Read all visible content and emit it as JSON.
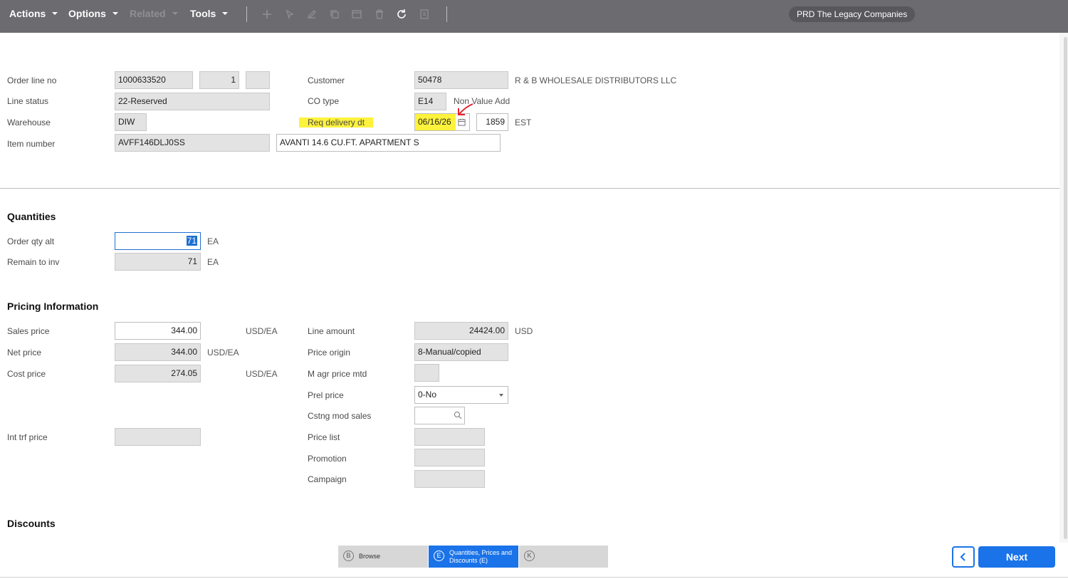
{
  "toolbar": {
    "menus": {
      "actions": "Actions",
      "options": "Options",
      "related": "Related",
      "tools": "Tools"
    },
    "icons": [
      "add-icon",
      "cursor-icon",
      "edit-icon",
      "copy-icon",
      "window-icon",
      "delete-icon",
      "refresh-icon",
      "note-icon"
    ],
    "company": "PRD The Legacy Companies"
  },
  "header": {
    "order_line_no": {
      "label": "Order line no",
      "order": "1000633520",
      "line": "1",
      "suffix": ""
    },
    "line_status": {
      "label": "Line status",
      "value": "22-Reserved"
    },
    "warehouse": {
      "label": "Warehouse",
      "value": "DIW"
    },
    "item_number": {
      "label": "Item number",
      "value": "AVFF146DLJ0SS",
      "description": "AVANTI 14.6 CU.FT. APARTMENT S"
    },
    "customer": {
      "label": "Customer",
      "value": "50478",
      "name": "R & B WHOLESALE DISTRIBUTORS LLC"
    },
    "co_type": {
      "label": "CO type",
      "value": "E14",
      "description": "Non Value Add"
    },
    "req_delivery": {
      "label": "Req delivery dt",
      "date": "06/16/26",
      "time": "1859",
      "timezone": "EST"
    }
  },
  "quantities": {
    "title": "Quantities",
    "order_qty_alt": {
      "label": "Order qty alt",
      "value": "71",
      "unit": "EA"
    },
    "remain_to_inv": {
      "label": "Remain to inv",
      "value": "71",
      "unit": "EA"
    }
  },
  "pricing": {
    "title": "Pricing Information",
    "sales_price": {
      "label": "Sales price",
      "value": "344.00",
      "unit": "USD/EA"
    },
    "net_price": {
      "label": "Net price",
      "value": "344.00",
      "unit": "USD/EA"
    },
    "cost_price": {
      "label": "Cost price",
      "value": "274.05",
      "unit": "USD/EA"
    },
    "int_trf_price": {
      "label": "Int trf price",
      "value": ""
    },
    "line_amount": {
      "label": "Line amount",
      "value": "24424.00",
      "unit": "USD"
    },
    "price_origin": {
      "label": "Price origin",
      "value": "8-Manual/copied"
    },
    "m_agr_price_mtd": {
      "label": "M agr price mtd",
      "value": ""
    },
    "prel_price": {
      "label": "Prel price",
      "value": "0-No"
    },
    "cstng_mod_sales": {
      "label": "Cstng mod sales",
      "value": ""
    },
    "price_list": {
      "label": "Price list",
      "value": ""
    },
    "promotion": {
      "label": "Promotion",
      "value": ""
    },
    "campaign": {
      "label": "Campaign",
      "value": ""
    }
  },
  "discounts": {
    "title": "Discounts"
  },
  "nav": {
    "steps": [
      {
        "key": "B",
        "label": "Browse"
      },
      {
        "key": "E",
        "label_line1": "Quantities, Prices and",
        "label_line2": "Discounts (E)"
      },
      {
        "key": "K",
        "label": ""
      }
    ],
    "next_label": "Next"
  },
  "colors": {
    "toolbar": "#6b6b70",
    "accent": "#1a73e8",
    "highlight": "#fdf23c",
    "annotation_arrow": "#e3212d"
  }
}
